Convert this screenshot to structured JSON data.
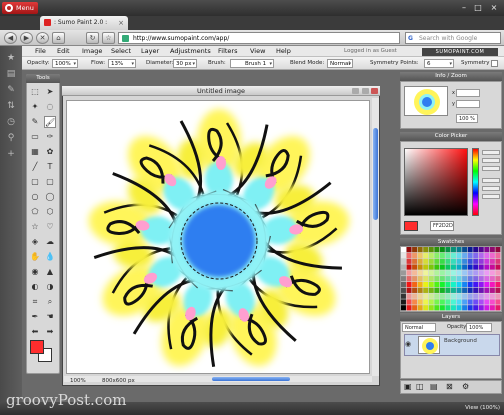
{
  "browser": {
    "menu_label": "Menu",
    "tab_title": ": Sumo Paint 2.0 :",
    "url": "http://www.sumopaint.com/app/",
    "search_placeholder": "Search with Google",
    "window_controls": [
      "–",
      "□",
      "×"
    ]
  },
  "app": {
    "menus": [
      "File",
      "Edit",
      "Image",
      "Select",
      "Layer",
      "Adjustments",
      "Filters",
      "View",
      "Help"
    ],
    "user_status": "Logged in as Guest",
    "logo_text": "SUMOPAINT.COM"
  },
  "options": {
    "opacity_label": "Opacity:",
    "opacity_value": "100%",
    "flow_label": "Flow:",
    "flow_value": "13%",
    "diameter_label": "Diameter:",
    "diameter_value": "30 px",
    "brush_label": "Brush:",
    "brush_value": "Brush 1",
    "blend_label": "Blend Mode:",
    "blend_value": "Normal",
    "symmetry_points_label": "Symmetry Points:",
    "symmetry_points_value": "6",
    "symmetry_label": "Symmetry"
  },
  "tools_panel": {
    "title": "Tools",
    "fg_color": "#ff2d2d",
    "bg_color": "#ffffff"
  },
  "image_window": {
    "title": "Untitled image",
    "zoom": "100%",
    "size": "800x600 px"
  },
  "info_zoom": {
    "title": "Info / Zoom",
    "x_label": "x",
    "y_label": "y",
    "zoom": "100 %"
  },
  "color_picker": {
    "title": "Color Picker",
    "hex": "FF2D2D",
    "current": "#ff2d2d"
  },
  "swatches": {
    "title": "Swatches"
  },
  "layers": {
    "title": "Layers",
    "mode": "Normal",
    "opacity_label": "Opacity:",
    "opacity_value": "100%",
    "layer_name": "Background"
  },
  "footer": {
    "view_label": "View (100%)",
    "watermark": "groovyPost.com"
  }
}
